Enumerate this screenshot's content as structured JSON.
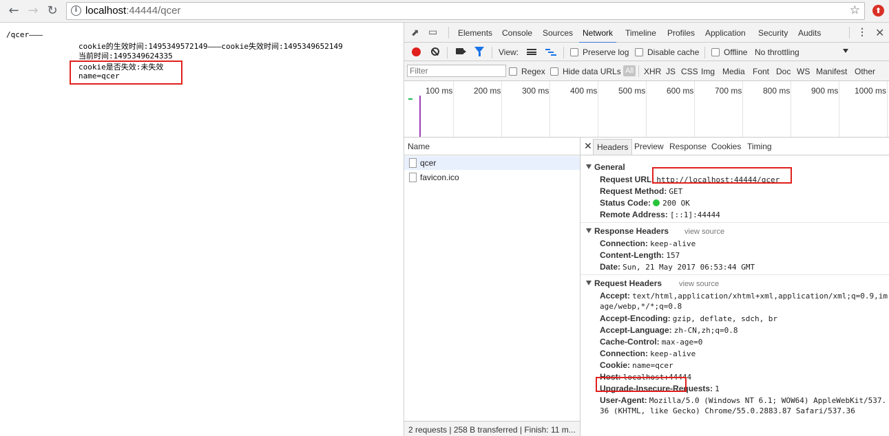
{
  "browser": {
    "back_icon": "arrow-left",
    "forward_icon": "arrow-right",
    "reload_icon": "reload",
    "url_host": "localhost",
    "url_path": ":44444/qcer",
    "star_icon": "star",
    "ext_icon_label": "⬆"
  },
  "page": {
    "line1": "/qcer———",
    "line2": "cookie的生效时间:1495349572149———cookie失效时间:1495349652149",
    "line3": "当前时间:1495349624335",
    "line4": "cookie是否失效:未失效",
    "line5": "name=qcer"
  },
  "devtools": {
    "tabs": [
      "Elements",
      "Console",
      "Sources",
      "Network",
      "Timeline",
      "Profiles",
      "Application",
      "Security",
      "Audits"
    ],
    "active_tab": "Network",
    "toolbar": {
      "view_label": "View:",
      "preserve_log": "Preserve log",
      "disable_cache": "Disable cache",
      "offline": "Offline",
      "throttling": "No throttling"
    },
    "filter": {
      "placeholder": "Filter",
      "regex": "Regex",
      "hide_data_urls": "Hide data URLs",
      "types": [
        "All",
        "XHR",
        "JS",
        "CSS",
        "Img",
        "Media",
        "Font",
        "Doc",
        "WS",
        "Manifest",
        "Other"
      ]
    },
    "timeline_labels": [
      "100 ms",
      "200 ms",
      "300 ms",
      "400 ms",
      "500 ms",
      "600 ms",
      "700 ms",
      "800 ms",
      "900 ms",
      "1000 ms"
    ],
    "requests": {
      "header": "Name",
      "items": [
        "qcer",
        "favicon.ico"
      ],
      "footer": "2 requests  |  258 B transferred  |  Finish: 11 m..."
    },
    "detail": {
      "tabs": [
        "Headers",
        "Preview",
        "Response",
        "Cookies",
        "Timing"
      ],
      "general": {
        "title": "General",
        "request_url_k": "Request URL:",
        "request_url_v": "http://localhost:44444/qcer",
        "request_method_k": "Request Method:",
        "request_method_v": "GET",
        "status_code_k": "Status Code:",
        "status_code_v": "200 OK",
        "remote_address_k": "Remote Address:",
        "remote_address_v": "[::1]:44444"
      },
      "response_headers": {
        "title": "Response Headers",
        "view_source": "view source",
        "connection_k": "Connection:",
        "connection_v": "keep-alive",
        "content_length_k": "Content-Length:",
        "content_length_v": "157",
        "date_k": "Date:",
        "date_v": "Sun, 21 May 2017 06:53:44 GMT"
      },
      "request_headers": {
        "title": "Request Headers",
        "view_source": "view source",
        "accept_k": "Accept:",
        "accept_v1": "text/html,application/xhtml+xml,application/xml;q=0.9,im",
        "accept_v2": "age/webp,*/*;q=0.8",
        "accept_encoding_k": "Accept-Encoding:",
        "accept_encoding_v": "gzip, deflate, sdch, br",
        "accept_language_k": "Accept-Language:",
        "accept_language_v": "zh-CN,zh;q=0.8",
        "cache_control_k": "Cache-Control:",
        "cache_control_v": "max-age=0",
        "connection_k": "Connection:",
        "connection_v": "keep-alive",
        "cookie_k": "Cookie:",
        "cookie_v": "name=qcer",
        "host_k": "Host:",
        "host_v": "localhost:44444",
        "upgrade_k": "Upgrade-Insecure-Requests:",
        "upgrade_v": "1",
        "user_agent_k": "User-Agent:",
        "user_agent_v1": "Mozilla/5.0 (Windows NT 6.1; WOW64) AppleWebKit/537.",
        "user_agent_v2": "36 (KHTML, like Gecko) Chrome/55.0.2883.87 Safari/537.36"
      }
    }
  },
  "colors": {
    "highlight_box": "#e0201c",
    "record_red": "#e0201c",
    "status_green": "#27c43a",
    "active_tab_underline": "#3879d9"
  }
}
